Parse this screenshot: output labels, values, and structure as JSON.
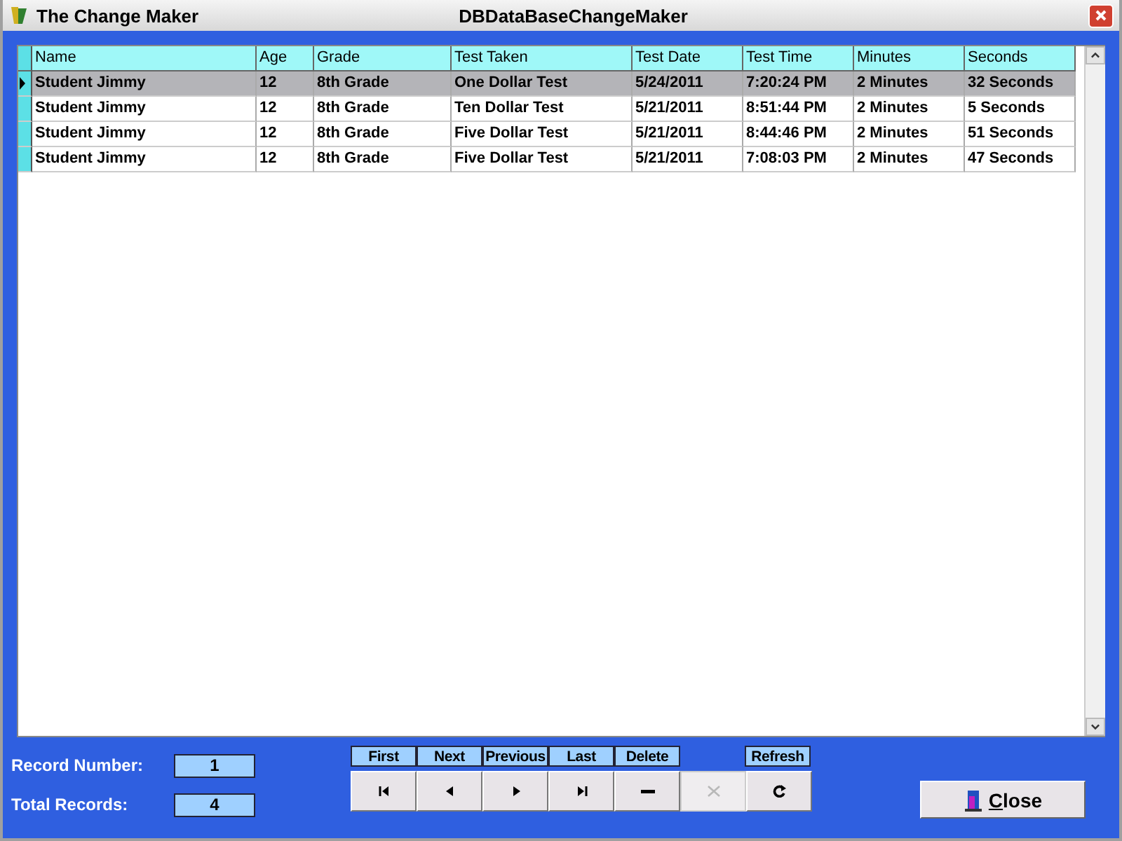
{
  "window": {
    "title": "The Change Maker",
    "caption": "DBDataBaseChangeMaker"
  },
  "table": {
    "columns": [
      "Name",
      "Age",
      "Grade",
      "Test Taken",
      "Test Date",
      "Test Time",
      "Minutes",
      "Seconds"
    ],
    "rows": [
      {
        "selected": true,
        "cells": [
          "Student Jimmy",
          "12",
          "8th Grade",
          "One Dollar Test",
          "5/24/2011",
          "7:20:24 PM",
          "2 Minutes",
          "32 Seconds"
        ]
      },
      {
        "selected": false,
        "cells": [
          "Student Jimmy",
          "12",
          "8th Grade",
          "Ten Dollar Test",
          "5/21/2011",
          "8:51:44 PM",
          "2 Minutes",
          "5 Seconds"
        ]
      },
      {
        "selected": false,
        "cells": [
          "Student Jimmy",
          "12",
          "8th Grade",
          "Five Dollar Test",
          "5/21/2011",
          "8:44:46 PM",
          "2 Minutes",
          "51 Seconds"
        ]
      },
      {
        "selected": false,
        "cells": [
          "Student Jimmy",
          "12",
          "8th Grade",
          "Five Dollar Test",
          "5/21/2011",
          "7:08:03 PM",
          "2 Minutes",
          "47 Seconds"
        ]
      }
    ]
  },
  "record_number": {
    "label": "Record Number:",
    "value": "1"
  },
  "total_records": {
    "label": "Total Records:",
    "value": "4"
  },
  "nav_captions": [
    "First",
    "Next",
    "Previous",
    "Last",
    "Delete"
  ],
  "refresh_caption": "Refresh",
  "nav_buttons": [
    {
      "kind": "first",
      "disabled": false
    },
    {
      "kind": "prev",
      "disabled": false
    },
    {
      "kind": "next",
      "disabled": false
    },
    {
      "kind": "last",
      "disabled": false
    },
    {
      "kind": "delete",
      "disabled": false
    },
    {
      "kind": "cancel",
      "disabled": true
    },
    {
      "kind": "refresh",
      "disabled": false
    }
  ],
  "close_button": {
    "label": "Close"
  }
}
